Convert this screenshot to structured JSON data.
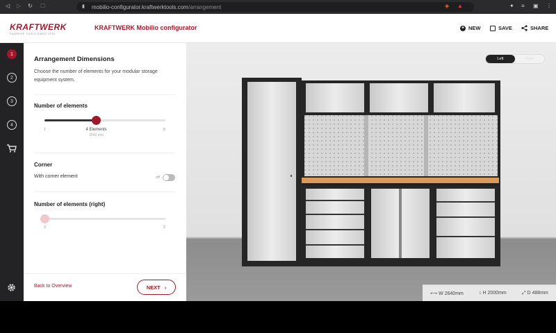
{
  "browser": {
    "url_host": "mobilio-configurator.kraftwerktools.com",
    "url_path": "/arrangement"
  },
  "header": {
    "logo_text": "KRAFTWERK",
    "logo_tagline": "FAVORITE TOOLS SINCE 1975",
    "title": "KRAFTWERK Mobilio configurator",
    "new_label": "NEW",
    "save_label": "SAVE",
    "share_label": "SHARE"
  },
  "steps": [
    "1",
    "2",
    "3",
    "4"
  ],
  "panel": {
    "title": "Arrangement Dimensions",
    "description": "Choose the number of elements for your modular storage equipment system.",
    "elements": {
      "label": "Number of elements",
      "min": "1",
      "max": "8",
      "value": 4,
      "value_label": "4 Elements",
      "value_sub": "2640 mm"
    },
    "corner": {
      "label": "Corner",
      "option_label": "With corner element",
      "toggle_state": "off",
      "toggle_text": "off"
    },
    "elements_right": {
      "label": "Number of elements (right)",
      "min": "0",
      "max": "2",
      "value": 0
    },
    "back_label": "Back to Overview",
    "next_label": "NEXT"
  },
  "view": {
    "toggle_left": "Left",
    "toggle_right": "Right",
    "width": "W 2640mm",
    "height": "H 2000mm",
    "depth": "D 488mm",
    "brand_label": "KRAFTWERK"
  },
  "colors": {
    "accent": "#a0182b",
    "rail": "#232325",
    "worktop": "#d99a5a"
  }
}
